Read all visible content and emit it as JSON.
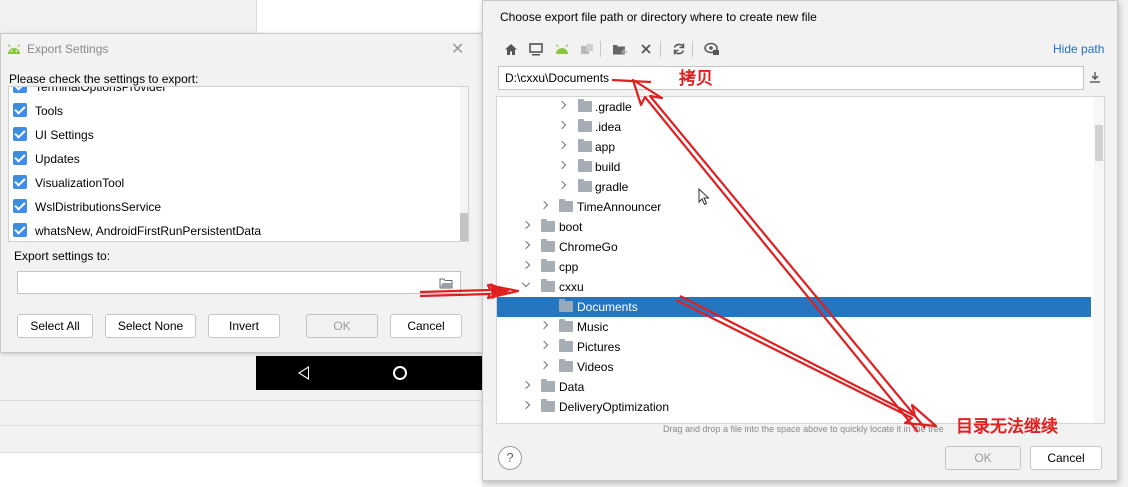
{
  "export_dialog": {
    "title": "Export Settings",
    "prompt": "Please check the settings to export:",
    "items": [
      {
        "label": "TerminalOptionsProvider",
        "checked": true
      },
      {
        "label": "Tools",
        "checked": true
      },
      {
        "label": "UI Settings",
        "checked": true
      },
      {
        "label": "Updates",
        "checked": true
      },
      {
        "label": "VisualizationTool",
        "checked": true
      },
      {
        "label": "WslDistributionsService",
        "checked": true
      },
      {
        "label": "whatsNew, AndroidFirstRunPersistentData",
        "checked": true
      }
    ],
    "export_to_label": "Export settings to:",
    "export_to_value": "",
    "buttons": {
      "select_all": "Select All",
      "select_none": "Select None",
      "invert": "Invert",
      "ok": "OK",
      "cancel": "Cancel"
    }
  },
  "file_dialog": {
    "header": "Choose export file path or directory where to create new file",
    "hide_path": "Hide path",
    "path_value": "D:\\cxxu\\Documents",
    "toolbar_icons": [
      "home-icon",
      "desktop-icon",
      "android-icon",
      "module-icon",
      "new-folder-icon",
      "delete-icon",
      "refresh-icon",
      "show-hidden-icon"
    ],
    "tree": [
      {
        "name": ".gradle",
        "expanded": false,
        "selected": false
      },
      {
        "name": ".idea",
        "expanded": false,
        "selected": false
      },
      {
        "name": "app",
        "expanded": false,
        "selected": false
      },
      {
        "name": "build",
        "expanded": false,
        "selected": false
      },
      {
        "name": "gradle",
        "expanded": false,
        "selected": false
      },
      {
        "name": "TimeAnnouncer",
        "expanded": false,
        "selected": false
      },
      {
        "name": "boot",
        "expanded": false,
        "selected": false
      },
      {
        "name": "ChromeGo",
        "expanded": false,
        "selected": false
      },
      {
        "name": "cpp",
        "expanded": false,
        "selected": false
      },
      {
        "name": "cxxu",
        "expanded": true,
        "selected": false
      },
      {
        "name": "Documents",
        "expanded": false,
        "selected": true
      },
      {
        "name": "Music",
        "expanded": false,
        "selected": false
      },
      {
        "name": "Pictures",
        "expanded": false,
        "selected": false
      },
      {
        "name": "Videos",
        "expanded": false,
        "selected": false
      },
      {
        "name": "Data",
        "expanded": false,
        "selected": false
      },
      {
        "name": "DeliveryOptimization",
        "expanded": false,
        "selected": false
      }
    ],
    "hint": "Drag and drop a file into the space above to quickly locate it in the tree",
    "buttons": {
      "ok": "OK",
      "cancel": "Cancel"
    },
    "help": "?"
  },
  "annotations": {
    "copy": "拷贝",
    "cannot_continue": "目录无法继续",
    "color": "#e02020"
  }
}
